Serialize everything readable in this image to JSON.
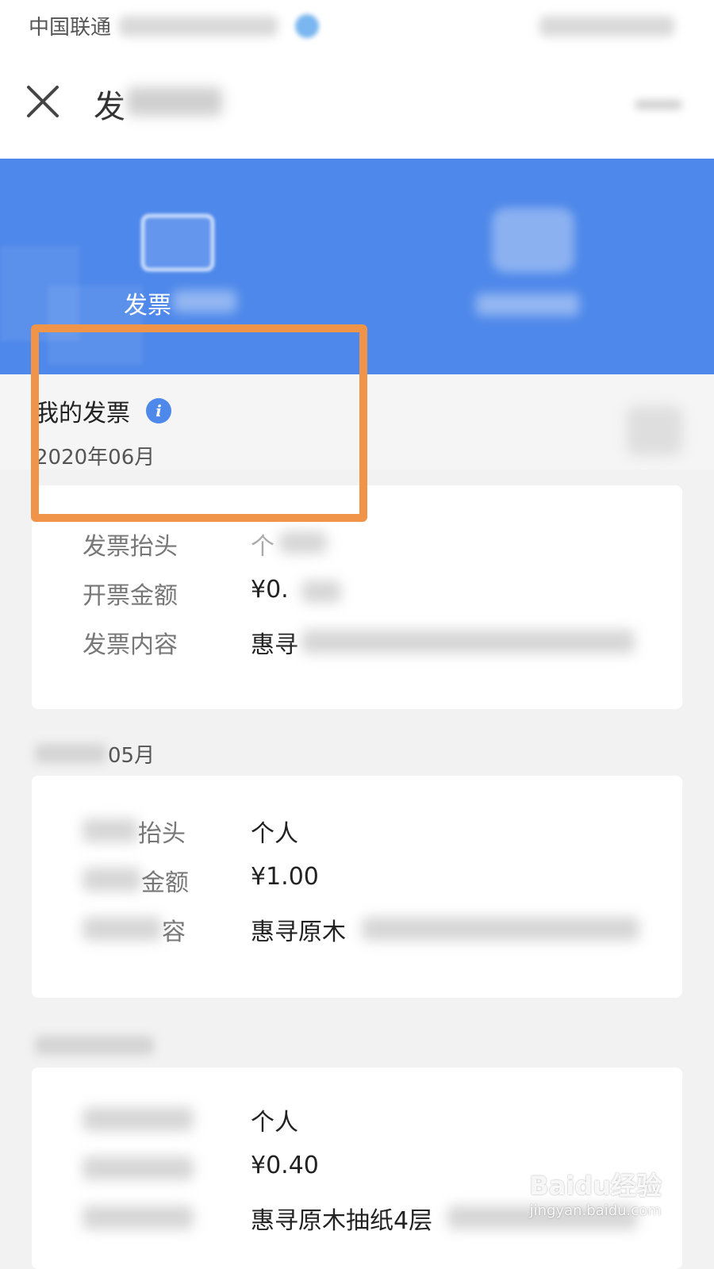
{
  "status_bar": {
    "carrier": "中国联通"
  },
  "nav": {
    "title": "发"
  },
  "tabs": [
    {
      "label": "发票",
      "icon": "invoice-icon"
    },
    {
      "label": "",
      "icon": "card-icon"
    }
  ],
  "section": {
    "title": "我的发票",
    "info_icon_glyph": "i",
    "month_label": "2020年06月"
  },
  "cards": [
    {
      "month_label": "05月",
      "rows": [
        {
          "label": "发票抬头",
          "value": "个"
        },
        {
          "label": "开票金额",
          "value": "¥0."
        },
        {
          "label": "发票内容",
          "value": "惠寻"
        }
      ]
    },
    {
      "rows": [
        {
          "label": "抬头",
          "value": "个人"
        },
        {
          "label": "金额",
          "value": "¥1.00"
        },
        {
          "label": "容",
          "value": "惠寻原木"
        }
      ]
    },
    {
      "rows": [
        {
          "label": "",
          "value": "个人"
        },
        {
          "label": "",
          "value": "¥0.40"
        },
        {
          "label": "",
          "value": "惠寻原木抽纸4层"
        }
      ]
    }
  ],
  "watermark": {
    "logo": "Baidu经验",
    "url": "jingyan.baidu.com"
  },
  "colors": {
    "primary": "#4e88ea",
    "highlight": "#f0944a",
    "background": "#f2f2f2"
  }
}
